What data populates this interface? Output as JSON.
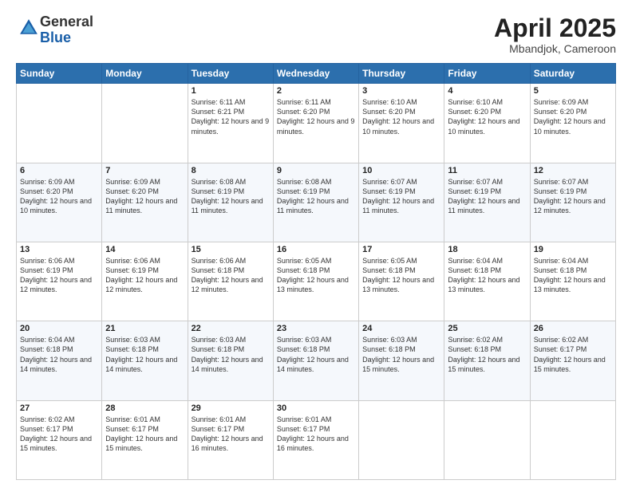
{
  "header": {
    "logo_general": "General",
    "logo_blue": "Blue",
    "title": "April 2025",
    "location": "Mbandjok, Cameroon"
  },
  "days_of_week": [
    "Sunday",
    "Monday",
    "Tuesday",
    "Wednesday",
    "Thursday",
    "Friday",
    "Saturday"
  ],
  "weeks": [
    [
      {
        "day": "",
        "info": ""
      },
      {
        "day": "",
        "info": ""
      },
      {
        "day": "1",
        "info": "Sunrise: 6:11 AM\nSunset: 6:21 PM\nDaylight: 12 hours and 9 minutes."
      },
      {
        "day": "2",
        "info": "Sunrise: 6:11 AM\nSunset: 6:20 PM\nDaylight: 12 hours and 9 minutes."
      },
      {
        "day": "3",
        "info": "Sunrise: 6:10 AM\nSunset: 6:20 PM\nDaylight: 12 hours and 10 minutes."
      },
      {
        "day": "4",
        "info": "Sunrise: 6:10 AM\nSunset: 6:20 PM\nDaylight: 12 hours and 10 minutes."
      },
      {
        "day": "5",
        "info": "Sunrise: 6:09 AM\nSunset: 6:20 PM\nDaylight: 12 hours and 10 minutes."
      }
    ],
    [
      {
        "day": "6",
        "info": "Sunrise: 6:09 AM\nSunset: 6:20 PM\nDaylight: 12 hours and 10 minutes."
      },
      {
        "day": "7",
        "info": "Sunrise: 6:09 AM\nSunset: 6:20 PM\nDaylight: 12 hours and 11 minutes."
      },
      {
        "day": "8",
        "info": "Sunrise: 6:08 AM\nSunset: 6:19 PM\nDaylight: 12 hours and 11 minutes."
      },
      {
        "day": "9",
        "info": "Sunrise: 6:08 AM\nSunset: 6:19 PM\nDaylight: 12 hours and 11 minutes."
      },
      {
        "day": "10",
        "info": "Sunrise: 6:07 AM\nSunset: 6:19 PM\nDaylight: 12 hours and 11 minutes."
      },
      {
        "day": "11",
        "info": "Sunrise: 6:07 AM\nSunset: 6:19 PM\nDaylight: 12 hours and 11 minutes."
      },
      {
        "day": "12",
        "info": "Sunrise: 6:07 AM\nSunset: 6:19 PM\nDaylight: 12 hours and 12 minutes."
      }
    ],
    [
      {
        "day": "13",
        "info": "Sunrise: 6:06 AM\nSunset: 6:19 PM\nDaylight: 12 hours and 12 minutes."
      },
      {
        "day": "14",
        "info": "Sunrise: 6:06 AM\nSunset: 6:19 PM\nDaylight: 12 hours and 12 minutes."
      },
      {
        "day": "15",
        "info": "Sunrise: 6:06 AM\nSunset: 6:18 PM\nDaylight: 12 hours and 12 minutes."
      },
      {
        "day": "16",
        "info": "Sunrise: 6:05 AM\nSunset: 6:18 PM\nDaylight: 12 hours and 13 minutes."
      },
      {
        "day": "17",
        "info": "Sunrise: 6:05 AM\nSunset: 6:18 PM\nDaylight: 12 hours and 13 minutes."
      },
      {
        "day": "18",
        "info": "Sunrise: 6:04 AM\nSunset: 6:18 PM\nDaylight: 12 hours and 13 minutes."
      },
      {
        "day": "19",
        "info": "Sunrise: 6:04 AM\nSunset: 6:18 PM\nDaylight: 12 hours and 13 minutes."
      }
    ],
    [
      {
        "day": "20",
        "info": "Sunrise: 6:04 AM\nSunset: 6:18 PM\nDaylight: 12 hours and 14 minutes."
      },
      {
        "day": "21",
        "info": "Sunrise: 6:03 AM\nSunset: 6:18 PM\nDaylight: 12 hours and 14 minutes."
      },
      {
        "day": "22",
        "info": "Sunrise: 6:03 AM\nSunset: 6:18 PM\nDaylight: 12 hours and 14 minutes."
      },
      {
        "day": "23",
        "info": "Sunrise: 6:03 AM\nSunset: 6:18 PM\nDaylight: 12 hours and 14 minutes."
      },
      {
        "day": "24",
        "info": "Sunrise: 6:03 AM\nSunset: 6:18 PM\nDaylight: 12 hours and 15 minutes."
      },
      {
        "day": "25",
        "info": "Sunrise: 6:02 AM\nSunset: 6:18 PM\nDaylight: 12 hours and 15 minutes."
      },
      {
        "day": "26",
        "info": "Sunrise: 6:02 AM\nSunset: 6:17 PM\nDaylight: 12 hours and 15 minutes."
      }
    ],
    [
      {
        "day": "27",
        "info": "Sunrise: 6:02 AM\nSunset: 6:17 PM\nDaylight: 12 hours and 15 minutes."
      },
      {
        "day": "28",
        "info": "Sunrise: 6:01 AM\nSunset: 6:17 PM\nDaylight: 12 hours and 15 minutes."
      },
      {
        "day": "29",
        "info": "Sunrise: 6:01 AM\nSunset: 6:17 PM\nDaylight: 12 hours and 16 minutes."
      },
      {
        "day": "30",
        "info": "Sunrise: 6:01 AM\nSunset: 6:17 PM\nDaylight: 12 hours and 16 minutes."
      },
      {
        "day": "",
        "info": ""
      },
      {
        "day": "",
        "info": ""
      },
      {
        "day": "",
        "info": ""
      }
    ]
  ]
}
